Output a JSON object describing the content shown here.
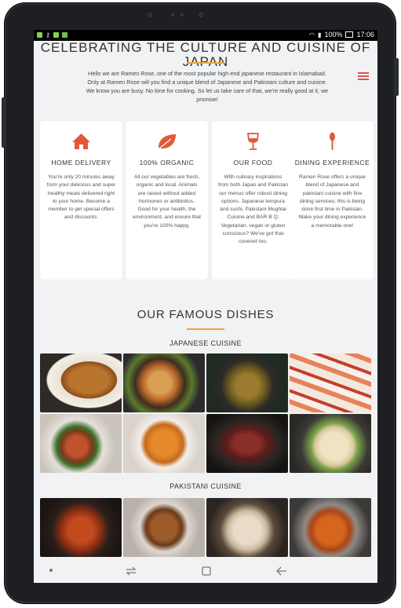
{
  "status_bar": {
    "battery": "100%",
    "time": "17:06"
  },
  "page": {
    "hero_title": "CELEBRATING THE CULTURE AND CUISINE OF JAPAN",
    "hero_text": "Hello we are Ramen Rose, one of the most popular high-end japanese restaurant in Islamabad. Only at Ramen Rose will you find a unique blend of Japanese and Pakistani culture and cuisine. We know you are busy. No time for cooking. So let us take care of that, we're really good at it, we promise!",
    "accent_color": "#f0a23a",
    "icon_color": "#e05a3a"
  },
  "features": [
    {
      "icon": "home-icon",
      "title": "HOME DELIVERY",
      "text": "You're only 20 minutes away from your delicious and super healthy meals delivered right to your home. Become a member to get special offers and discounts."
    },
    {
      "icon": "leaf-icon",
      "title": "100% ORGANIC",
      "text": "All our vegetables are fresh, organic and local. Animals are raised without added hormones or antibiotics. Good for your health, the environment, and ensure that you're 100% happy."
    },
    {
      "icon": "wine-glass-icon",
      "title": "OUR FOOD",
      "text": "With culinary inspirations from both Japan and Pakistan our menus offer robust dining options. Japanese tempura and sushi, Pakistani Mughlai Cuisine and BAR B Q; Vegetarian, vegan or gluten conscious? We've got that covered too."
    },
    {
      "icon": "spoon-icon",
      "title": "DINING EXPERIENCE",
      "text": "Ramen Rose offers a unique blend of Japanese and pakistani cuisine with fine dining services; this is being done first time in Pakistan. Make your dining experience a memorable one!"
    }
  ],
  "dishes": {
    "title": "OUR FAMOUS DISHES",
    "japanese_label": "JAPANESE CUISINE",
    "pakistani_label": "PAKISTANI CUISINE",
    "japanese": [
      "fried-cutlet-photo",
      "dumplings-photo",
      "noodles-photo",
      "sushi-rolls-photo",
      "stir-fry-photo",
      "mapo-tofu-photo",
      "sliced-steak-photo",
      "fried-rice-photo"
    ],
    "pakistani": [
      "chicken-karahi-photo",
      "spaghetti-photo",
      "biryani-photo",
      "curry-photo"
    ]
  }
}
